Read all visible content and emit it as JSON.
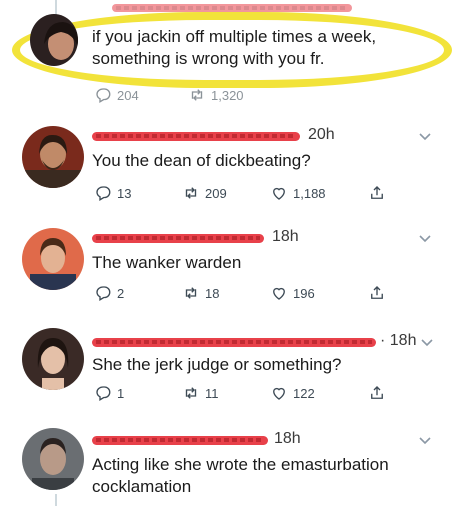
{
  "tweets": [
    {
      "text_lines": [
        "if you jackin off multiple times a week,",
        "something is wrong with you fr."
      ],
      "stats": {
        "reply": "204",
        "retweet": "1,320"
      }
    },
    {
      "time": "20h",
      "text": "You the dean of dickbeating?",
      "stats": {
        "reply": "13",
        "retweet": "209",
        "like": "1,188"
      }
    },
    {
      "time": "18h",
      "text": "The wanker warden",
      "stats": {
        "reply": "2",
        "retweet": "18",
        "like": "196"
      }
    },
    {
      "time": "· 18h",
      "text": "She the jerk judge or something?",
      "stats": {
        "reply": "1",
        "retweet": "11",
        "like": "122"
      }
    },
    {
      "time": "18h",
      "text_lines": [
        "Acting like she wrote the emasturbation",
        "cocklamation"
      ]
    }
  ],
  "colors": {
    "highlight": "#f2e33a",
    "redaction": "#e8414a",
    "icon": "#3d4a55"
  },
  "icons": [
    "reply-icon",
    "retweet-icon",
    "like-icon",
    "share-icon",
    "chevron-down-icon"
  ]
}
